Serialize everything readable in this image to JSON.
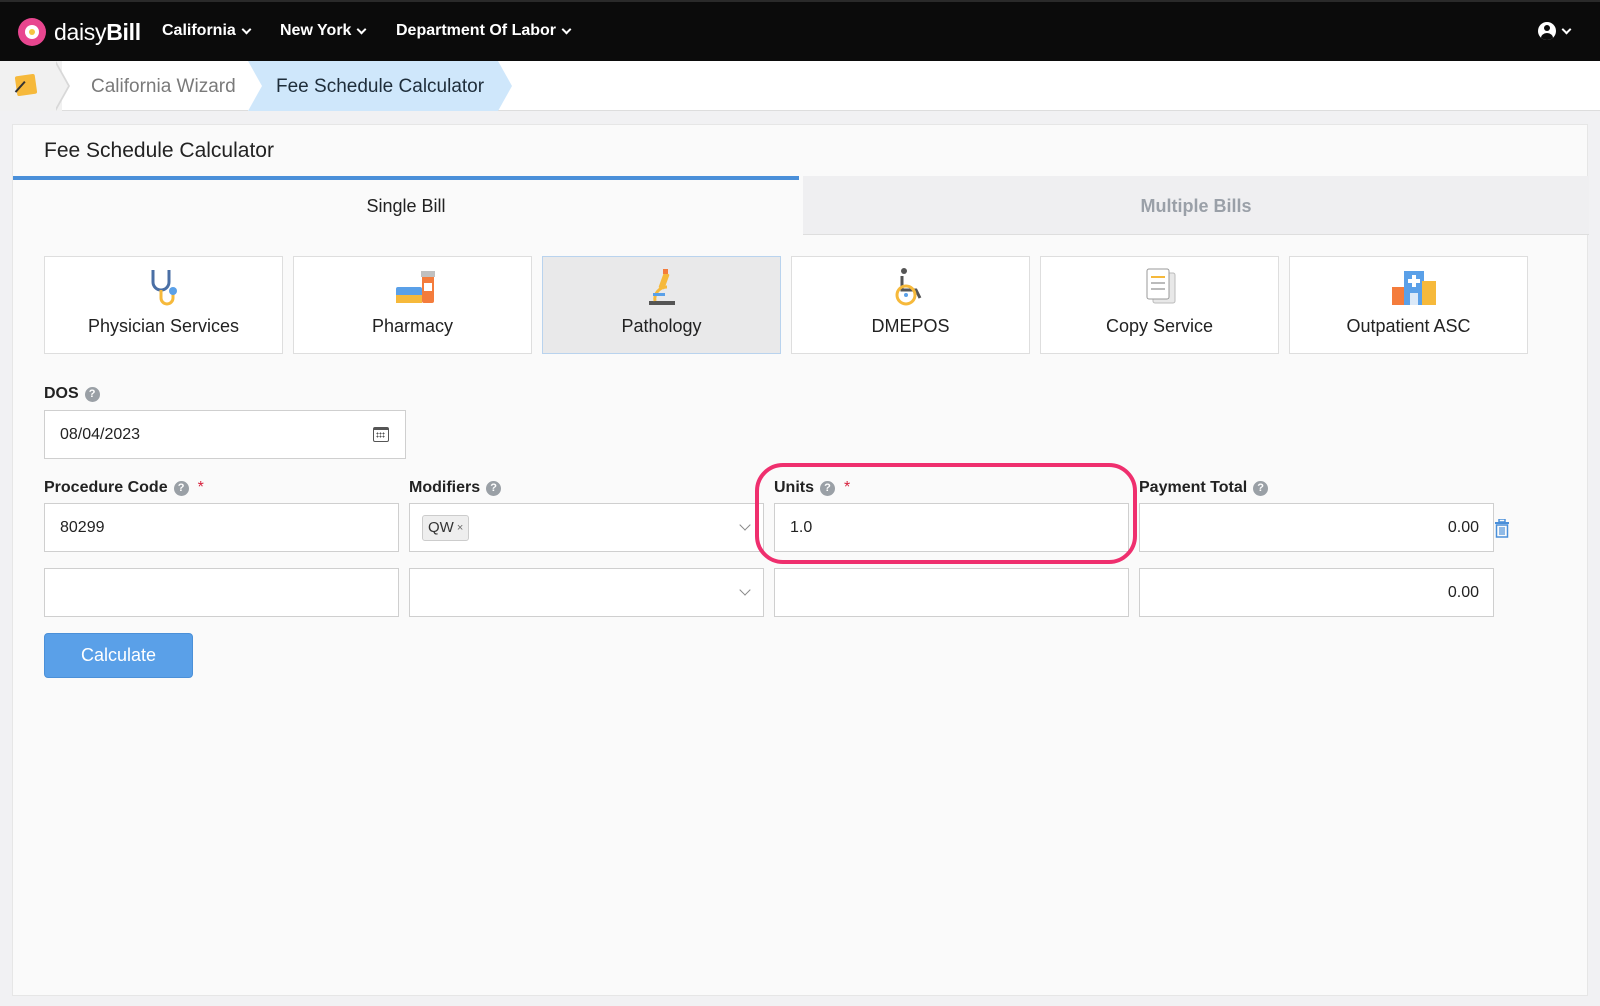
{
  "brand": {
    "name_light": "daisy",
    "name_bold": "Bill"
  },
  "nav": {
    "items": [
      {
        "label": "California"
      },
      {
        "label": "New York"
      },
      {
        "label": "Department Of Labor"
      }
    ],
    "user_icon": "user-circle-icon"
  },
  "breadcrumb": {
    "home_icon": "notepad-icon",
    "items": [
      {
        "label": "California Wizard"
      },
      {
        "label": "Fee Schedule Calculator",
        "active": true
      }
    ]
  },
  "panel": {
    "title": "Fee Schedule Calculator",
    "tabs": [
      {
        "label": "Single Bill",
        "active": true
      },
      {
        "label": "Multiple Bills",
        "active": false
      }
    ],
    "services": [
      {
        "label": "Physician Services",
        "icon": "stethoscope-icon"
      },
      {
        "label": "Pharmacy",
        "icon": "pharmacy-icon"
      },
      {
        "label": "Pathology",
        "icon": "microscope-icon",
        "active": true
      },
      {
        "label": "DMEPOS",
        "icon": "wheelchair-icon"
      },
      {
        "label": "Copy Service",
        "icon": "document-copy-icon"
      },
      {
        "label": "Outpatient ASC",
        "icon": "hospital-icon"
      }
    ]
  },
  "form": {
    "dos_label": "DOS",
    "dos_value": "08/04/2023",
    "procedure_label": "Procedure Code",
    "modifiers_label": "Modifiers",
    "units_label": "Units",
    "payment_label": "Payment Total",
    "required_mark": "*",
    "help_glyph": "?",
    "rows": [
      {
        "procedure": "80299",
        "modifier": "QW",
        "modifier_remove": "×",
        "units": "1.0",
        "payment": "0.00"
      },
      {
        "procedure": "",
        "modifier": "",
        "units": "",
        "payment": "0.00"
      }
    ],
    "calculate_label": "Calculate"
  },
  "colors": {
    "accent": "#4a8fd9",
    "button": "#5aa0e8",
    "highlight": "#ef2f6e",
    "required": "#d61f3b"
  }
}
